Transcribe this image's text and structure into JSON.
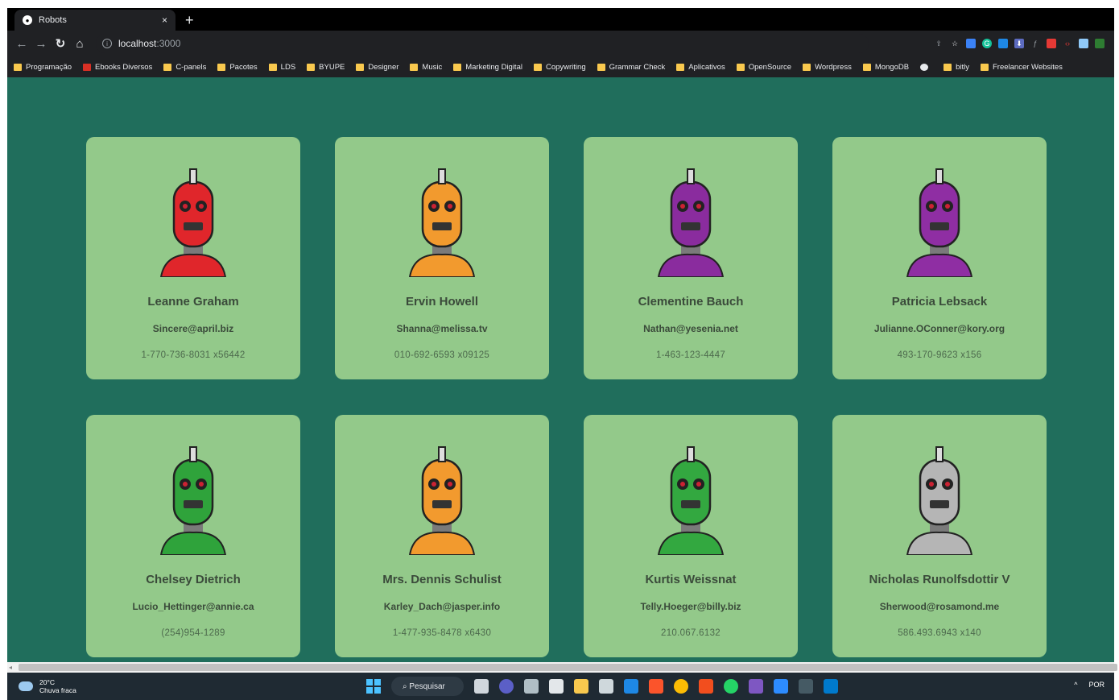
{
  "browser": {
    "tab_title": "Robots",
    "tab_close": "×",
    "new_tab": "+",
    "address_host": "localhost",
    "address_port": ":3000"
  },
  "bookmarks": [
    {
      "label": "Programação",
      "icon": "folder"
    },
    {
      "label": "Ebooks Diversos",
      "icon": "red"
    },
    {
      "label": "C-panels",
      "icon": "folder"
    },
    {
      "label": "Pacotes",
      "icon": "folder"
    },
    {
      "label": "LDS",
      "icon": "folder"
    },
    {
      "label": "BYUPE",
      "icon": "folder"
    },
    {
      "label": "Designer",
      "icon": "folder"
    },
    {
      "label": "Music",
      "icon": "folder"
    },
    {
      "label": "Marketing Digital",
      "icon": "folder"
    },
    {
      "label": "Copywriting",
      "icon": "folder"
    },
    {
      "label": "Grammar Check",
      "icon": "folder"
    },
    {
      "label": "Aplicativos",
      "icon": "folder"
    },
    {
      "label": "OpenSource",
      "icon": "folder"
    },
    {
      "label": "Wordpress",
      "icon": "folder"
    },
    {
      "label": "MongoDB",
      "icon": "folder"
    },
    {
      "label": "",
      "icon": "globe"
    },
    {
      "label": "bitly",
      "icon": "folder"
    },
    {
      "label": "Freelancer Websites",
      "icon": "folder"
    }
  ],
  "robots": [
    {
      "name": "Leanne Graham",
      "email": "Sincere@april.biz",
      "phone": "1-770-736-8031 x56442",
      "color": "#e0262b"
    },
    {
      "name": "Ervin Howell",
      "email": "Shanna@melissa.tv",
      "phone": "010-692-6593 x09125",
      "color": "#f29a2e"
    },
    {
      "name": "Clementine Bauch",
      "email": "Nathan@yesenia.net",
      "phone": "1-463-123-4447",
      "color": "#8a2c9e"
    },
    {
      "name": "Patricia Lebsack",
      "email": "Julianne.OConner@kory.org",
      "phone": "493-170-9623 x156",
      "color": "#8f2ea3"
    },
    {
      "name": "Chelsey Dietrich",
      "email": "Lucio_Hettinger@annie.ca",
      "phone": "(254)954-1289",
      "color": "#2fa33b"
    },
    {
      "name": "Mrs. Dennis Schulist",
      "email": "Karley_Dach@jasper.info",
      "phone": "1-477-935-8478 x6430",
      "color": "#f29a2e"
    },
    {
      "name": "Kurtis Weissnat",
      "email": "Telly.Hoeger@billy.biz",
      "phone": "210.067.6132",
      "color": "#33a840"
    },
    {
      "name": "Nicholas Runolfsdottir V",
      "email": "Sherwood@rosamond.me",
      "phone": "586.493.6943 x140",
      "color": "#b5b5b5"
    }
  ],
  "taskbar": {
    "weather_temp": "20°C",
    "weather_desc": "Chuva fraca",
    "search_label": "Pesquisar",
    "lang": "POR",
    "tray_chevron": "^"
  }
}
